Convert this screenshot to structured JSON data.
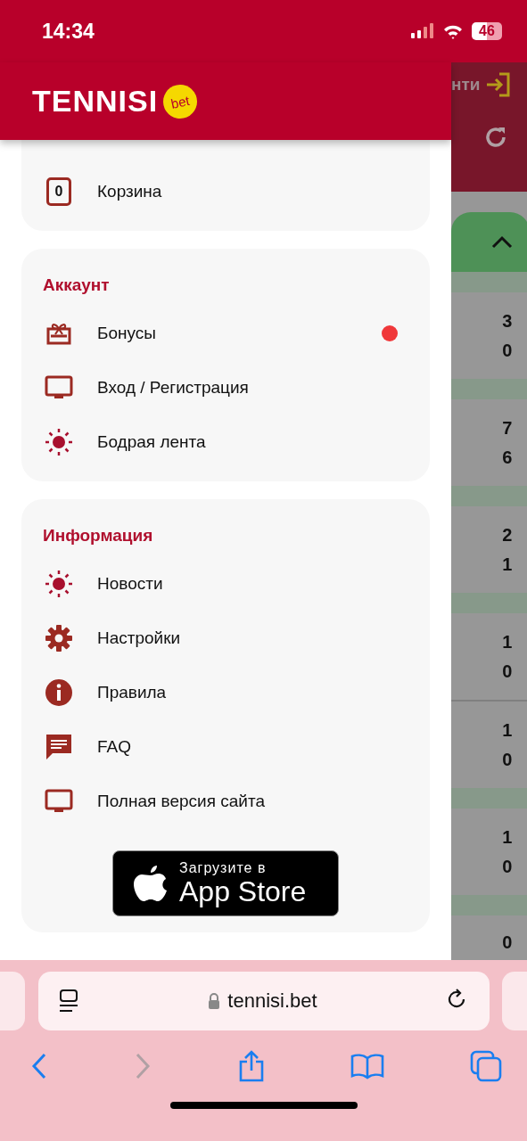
{
  "status_bar": {
    "time": "14:34",
    "battery": "46"
  },
  "header": {
    "logo": "TENNISI",
    "badge": "bet"
  },
  "background_page": {
    "header_text": "нти",
    "rows": [
      {
        "score_1": "3",
        "score_2": "0"
      },
      {
        "score_1": "7",
        "score_2": "6"
      },
      {
        "score_1": "2",
        "score_2": "1"
      },
      {
        "score_1": "1",
        "score_2": "0"
      },
      {
        "score_1": "1",
        "score_2": "0"
      },
      {
        "score_1": "1",
        "score_2": "0"
      },
      {
        "score_1": "0"
      }
    ]
  },
  "menu_sections": [
    {
      "items": [
        {
          "kind": "ticket",
          "label": "Корзина",
          "counter": "0",
          "notification": false
        }
      ]
    },
    {
      "title": "Аккаунт",
      "items": [
        {
          "kind": "gift",
          "label": "Бонусы",
          "notification": true
        },
        {
          "kind": "monitor",
          "label": "Вход / Регистрация",
          "notification": false
        },
        {
          "kind": "sun",
          "label": "Бодрая лента",
          "notification": false
        }
      ]
    },
    {
      "title": "Информация",
      "items": [
        {
          "kind": "sun",
          "label": "Новости",
          "notification": false
        },
        {
          "kind": "gear",
          "label": "Настройки",
          "notification": false
        },
        {
          "kind": "info",
          "label": "Правила",
          "notification": false
        },
        {
          "kind": "chat",
          "label": "FAQ",
          "notification": false
        },
        {
          "kind": "monitor",
          "label": "Полная версия сайта",
          "notification": false
        }
      ]
    }
  ],
  "app_store_badge": {
    "small_text": "Загрузите в",
    "large_text": "App Store"
  },
  "browser": {
    "url": "tennisi.bet",
    "back_disabled": false,
    "forward_disabled": true
  }
}
